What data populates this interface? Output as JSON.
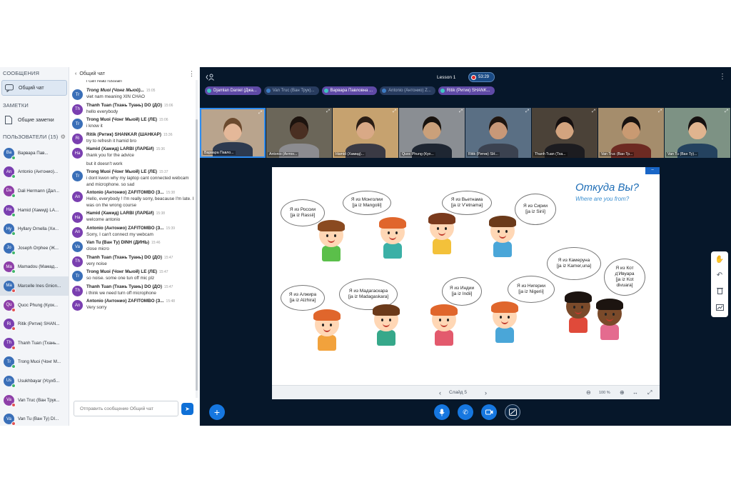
{
  "sidebar": {
    "messages_title": "СООБЩЕНИЯ",
    "public_chat_label": "Общий чат",
    "notes_title": "ЗАМЕТКИ",
    "shared_notes_label": "Общие заметки",
    "users_title": "ПОЛЬЗОВАТЕЛИ (15)",
    "users": [
      {
        "initials": "Ba",
        "name": "Варвара Пав...",
        "color": "#3a6fb8",
        "status": "#41b56a",
        "selected": false
      },
      {
        "initials": "An",
        "name": "Antonio (Антонио)...",
        "color": "#7a3fb0",
        "status": "#41b56a",
        "selected": false
      },
      {
        "initials": "Da",
        "name": "Dali Hermann (Дал...",
        "color": "#8e3fa8",
        "status": "#41b56a",
        "selected": false
      },
      {
        "initials": "Ha",
        "name": "Hamid (Хамид) LA...",
        "color": "#7a3fb0",
        "status": "#41b56a",
        "selected": false
      },
      {
        "initials": "Hy",
        "name": "Hyllary Ornella (Хи...",
        "color": "#3a6fb8",
        "status": "#41b56a",
        "selected": false
      },
      {
        "initials": "Jo",
        "name": "Joseph Orphee (Ж...",
        "color": "#3a6fb8",
        "status": "#41b56a",
        "selected": false
      },
      {
        "initials": "Ma",
        "name": "Mamadou (Мамад...",
        "color": "#8e3fa8",
        "status": "#41b56a",
        "selected": false
      },
      {
        "initials": "Ma",
        "name": "Marcelle Ines Gnion...",
        "color": "#3a6fb8",
        "status": "#e05353",
        "selected": true
      },
      {
        "initials": "Qu",
        "name": "Quoc Phung (Куок...",
        "color": "#8e3fa8",
        "status": "#e05353",
        "selected": false
      },
      {
        "initials": "Ri",
        "name": "Ritik (Ритик) SHAN...",
        "color": "#7a3fb0",
        "status": "#e05353",
        "selected": false
      },
      {
        "initials": "Th",
        "name": "Thanh Tuan (Тхань...",
        "color": "#7a3fb0",
        "status": "#e05353",
        "selected": false
      },
      {
        "initials": "Tr",
        "name": "Trong Muoi (Чонг М...",
        "color": "#3a6fb8",
        "status": "#41b56a",
        "selected": false
      },
      {
        "initials": "Us",
        "name": "Usukhbayar (Усухб...",
        "color": "#3a6fb8",
        "status": "#41b56a",
        "selected": false
      },
      {
        "initials": "Va",
        "name": "Van Truc (Ван Трук...",
        "color": "#8e3fa8",
        "status": "#e05353",
        "selected": false
      },
      {
        "initials": "Va",
        "name": "Van Tu (Ван Ту) DI...",
        "color": "#3a6fb8",
        "status": "#e05353",
        "selected": false
      }
    ]
  },
  "chat": {
    "title": "Общий чат",
    "first_line": "i can read russian",
    "input_placeholder": "Отправить сообщение Общий чат",
    "messages": [
      {
        "initials": "Tr",
        "color": "#3a6fb8",
        "name": "Trong Muoi (Чонг Мыой)...",
        "time": "15:05",
        "italic": true,
        "texts": [
          "viet nam meaning XIN CHAO"
        ]
      },
      {
        "initials": "Th",
        "color": "#7a3fb0",
        "name": "Thanh Tuan (Тхань Туань) DO (ДО)",
        "time": "15:06",
        "italic": false,
        "texts": [
          "hello everybody"
        ]
      },
      {
        "initials": "Tr",
        "color": "#3a6fb8",
        "name": "Trong Muoi (Чонг Мыой) LE (ЛЕ)",
        "time": "15:06",
        "italic": false,
        "texts": [
          "i know it"
        ]
      },
      {
        "initials": "Ri",
        "color": "#7a3fb0",
        "name": "Ritik (Ритик) SHANKAR (ШАНКАР)",
        "time": "15:36",
        "italic": false,
        "texts": [
          "try to refresh it hamid bro"
        ]
      },
      {
        "initials": "Ha",
        "color": "#7a3fb0",
        "name": "Hamid (Хамид) LARBI (ЛАРБИ)",
        "time": "15:36",
        "italic": false,
        "texts": [
          "thank you for the advice",
          "but it doesn't work"
        ]
      },
      {
        "initials": "Tr",
        "color": "#3a6fb8",
        "name": "Trong Muoi (Чонг Мыой) LE (ЛЕ)",
        "time": "15:37",
        "italic": false,
        "texts": [
          "i dont kwon why my laptop cant connected webcam and microphone. so sad"
        ]
      },
      {
        "initials": "An",
        "color": "#7a3fb0",
        "name": "Antonio (Антонио) ZAFITOMBO (З...",
        "time": "15:38",
        "italic": false,
        "texts": [
          "Hello, everybody ! I'm really sorry, beacause I'm late. I was on the wrong course"
        ]
      },
      {
        "initials": "Ha",
        "color": "#7a3fb0",
        "name": "Hamid (Хамид) LARBI (ЛАРБИ)",
        "time": "15:38",
        "italic": false,
        "texts": [
          "welcome antonio"
        ]
      },
      {
        "initials": "An",
        "color": "#7a3fb0",
        "name": "Antonio (Антонио) ZAFITOMBO (З...",
        "time": "15:39",
        "italic": false,
        "texts": [
          "Sorry, I can't connect my webcam"
        ]
      },
      {
        "initials": "Va",
        "color": "#3a6fb8",
        "name": "Van Tu (Ван Ту) DINH (ДИНЬ)",
        "time": "15:46",
        "italic": false,
        "texts": [
          "close micro"
        ]
      },
      {
        "initials": "Th",
        "color": "#7a3fb0",
        "name": "Thanh Tuan (Тхань Туань) DO (ДО)",
        "time": "15:47",
        "italic": false,
        "texts": [
          "very noise"
        ]
      },
      {
        "initials": "Tr",
        "color": "#3a6fb8",
        "name": "Trong Muoi (Чонг Мыой) LE (ЛЕ)",
        "time": "15:47",
        "italic": false,
        "texts": [
          "so noise. some one tun off mic plz"
        ]
      },
      {
        "initials": "Th",
        "color": "#7a3fb0",
        "name": "Thanh Tuan (Тхань Туань) DO (ДО)",
        "time": "15:47",
        "italic": false,
        "texts": [
          "i think we need turn off microphone"
        ]
      },
      {
        "initials": "An",
        "color": "#7a3fb0",
        "name": "Antonio (Антонио) ZAFITOMBO (З...",
        "time": "15:48",
        "italic": false,
        "texts": [
          "Very sorry"
        ]
      }
    ]
  },
  "topbar": {
    "lesson_title": "Lesson 1",
    "record_time": "53:29",
    "talkers": [
      {
        "name": "Djamlan Daniel (Джа...",
        "active": true
      },
      {
        "name": "Van Truc (Ван Трук)...",
        "active": false
      },
      {
        "name": "Варвара Павловна ...",
        "active": true
      },
      {
        "name": "Antonio (Антонио) Z...",
        "active": false
      },
      {
        "name": "Ritik (Ритик) SHANK...",
        "active": true
      }
    ]
  },
  "videos": [
    {
      "label": "Варвара Павло...",
      "bg": "#b9a48d",
      "skin": "#e4b899",
      "shirt": "#2d3a4f",
      "hair": "#6b4a2e"
    },
    {
      "label": "Antonio (Антон...",
      "bg": "#6b6659",
      "skin": "#4a2f22",
      "shirt": "#8c8c90",
      "hair": "#1c130e"
    },
    {
      "label": "Hamid (Хамид)...",
      "bg": "#c6a26f",
      "skin": "#d9a986",
      "shirt": "#3a3a44",
      "hair": "#2a1d14"
    },
    {
      "label": "Quoc Phung (Куо...",
      "bg": "#8a8e93",
      "skin": "#caa07a",
      "shirt": "#1e2632",
      "hair": "#17120e"
    },
    {
      "label": "Ritik (Ритик) SH...",
      "bg": "#5a6f84",
      "skin": "#c89878",
      "shirt": "#3b4250",
      "hair": "#1e1510"
    },
    {
      "label": "Thanh Tuan (Тха...",
      "bg": "#4b4238",
      "skin": "#d3a47f",
      "shirt": "#1c1c20",
      "hair": "#151010"
    },
    {
      "label": "Van Truc (Ван Тр...",
      "bg": "#a58d6c",
      "skin": "#c99a72",
      "shirt": "#6d2a22",
      "hair": "#181210"
    },
    {
      "label": "Van Tu (Ван Ту)...",
      "bg": "#7d9284",
      "skin": "#e0b48f",
      "shirt": "#24425f",
      "hair": "#141010"
    }
  ],
  "slide": {
    "title": "Откуда Вы?",
    "subtitle": "Where are you from?",
    "bubbles": [
      {
        "lines": [
          "Я из России",
          "[ja iz Rassii]"
        ]
      },
      {
        "lines": [
          "Я из Монголии",
          "[ja iz Mangolii]"
        ]
      },
      {
        "lines": [
          "Я из Вьетнама",
          "[ja iz V'etnama]"
        ]
      },
      {
        "lines": [
          "Я из Сирии",
          "[ja iz Sirii]"
        ]
      },
      {
        "lines": [
          "Я из Камеруна",
          "[ja iz Kamer,una]"
        ]
      },
      {
        "lines": [
          "Я из Кот",
          "д'Ивуара",
          "[ja iz Kot",
          "divuara]"
        ]
      },
      {
        "lines": [
          "Я из Алжира",
          "[ja iz Alzhira]"
        ]
      },
      {
        "lines": [
          "Я из Мадагаскара",
          "[ja iz Madagaskara]"
        ]
      },
      {
        "lines": [
          "Я из Индии",
          "[ja iz Indii]"
        ]
      },
      {
        "lines": [
          "Я из Нигерии",
          "[ja iz Nigerii]"
        ]
      }
    ],
    "toolbar": {
      "slide_label": "Слайд 5",
      "zoom": "100 %"
    }
  },
  "icons": {
    "chat": "chat-bubble-icon",
    "notes": "notes-icon",
    "gear": "gear-icon",
    "mic": "microphone-icon",
    "phone": "phone-icon",
    "camera": "video-camera-icon",
    "screen": "screen-share-icon",
    "plus": "plus-icon",
    "hand": "hand-icon",
    "undo": "undo-icon",
    "trash": "trash-icon",
    "chart": "chart-icon"
  },
  "colors": {
    "accent": "#1677e0",
    "main_bg": "#06172a",
    "talker": "#5f4aa6"
  }
}
